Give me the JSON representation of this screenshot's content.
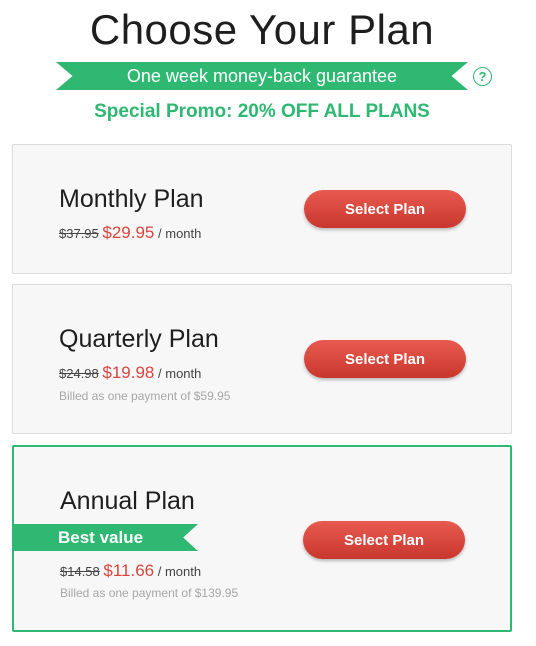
{
  "header": {
    "title": "Choose Your Plan",
    "guarantee": "One week money-back guarantee",
    "help_icon": "?",
    "promo": "Special Promo: 20% OFF ALL PLANS"
  },
  "plans": [
    {
      "name": "Monthly Plan",
      "old_price": "$37.95",
      "new_price": "$29.95",
      "per": "/ month",
      "billed": "",
      "button": "Select Plan"
    },
    {
      "name": "Quarterly Plan",
      "old_price": "$24.98",
      "new_price": "$19.98",
      "per": "/ month",
      "billed": "Billed as one payment of $59.95",
      "button": "Select Plan"
    },
    {
      "name": "Annual Plan",
      "badge": "Best value",
      "old_price": "$14.58",
      "new_price": "$11.66",
      "per": "/ month",
      "billed": "Billed as one payment of $139.95",
      "button": "Select Plan"
    }
  ],
  "colors": {
    "accent_green": "#2eb872",
    "price_red": "#d9453f",
    "button_red": "#d9453f"
  },
  "icons": {
    "help": "question-circle-icon"
  }
}
